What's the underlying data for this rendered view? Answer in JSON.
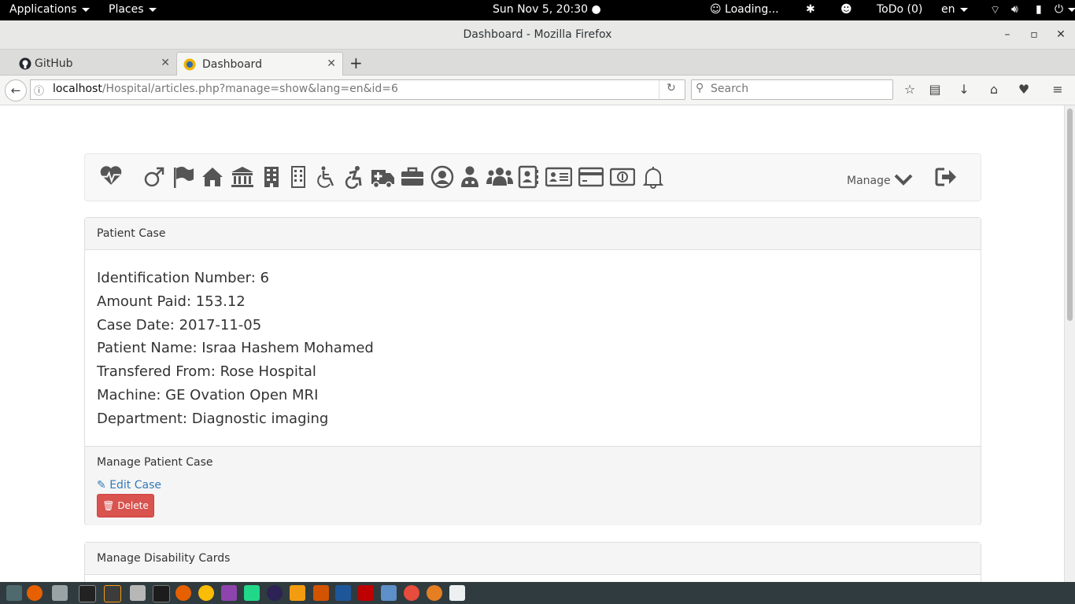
{
  "topbar": {
    "applications": "Applications",
    "places": "Places",
    "clock": "Sun Nov  5, 20:30",
    "loading": "Loading...",
    "todo": "ToDo (0)",
    "lang": "en"
  },
  "window": {
    "title": "Dashboard - Mozilla Firefox"
  },
  "tabs": [
    {
      "label": "GitHub",
      "icon": "github-icon"
    },
    {
      "label": "Dashboard",
      "icon": "favicon-icon"
    }
  ],
  "nav": {
    "url_host": "localhost",
    "url_path": "/Hospital/articles.php?manage=show&lang=en&id=6",
    "search_placeholder": "Search"
  },
  "app_nav": {
    "manage_label": "Manage",
    "icons": [
      "heartbeat-icon",
      "male-icon",
      "flag-icon",
      "home-icon",
      "bank-icon",
      "building-icon",
      "building-outline-icon",
      "wheelchair-icon",
      "accessible-icon",
      "ambulance-icon",
      "briefcase-icon",
      "user-circle-icon",
      "user-md-icon",
      "users-icon",
      "address-book-icon",
      "id-card-icon",
      "credit-card-icon",
      "money-icon",
      "bell-icon"
    ]
  },
  "patient_case": {
    "heading": "Patient Case",
    "fields": [
      "Identification Number: 6",
      "Amount Paid: 153.12",
      "Case Date: 2017-11-05",
      "Patient Name: Israa Hashem Mohamed",
      "Transfered From: Rose Hospital",
      "Machine: GE Ovation Open MRI",
      "Department: Diagnostic imaging"
    ],
    "manage_heading": "Manage Patient Case",
    "edit_label": "Edit Case",
    "delete_label": "Delete"
  },
  "disability": {
    "heading": "Manage Disability Cards"
  },
  "colors": {
    "link": "#337ab7",
    "danger": "#d9534f",
    "icon": "#555555"
  }
}
